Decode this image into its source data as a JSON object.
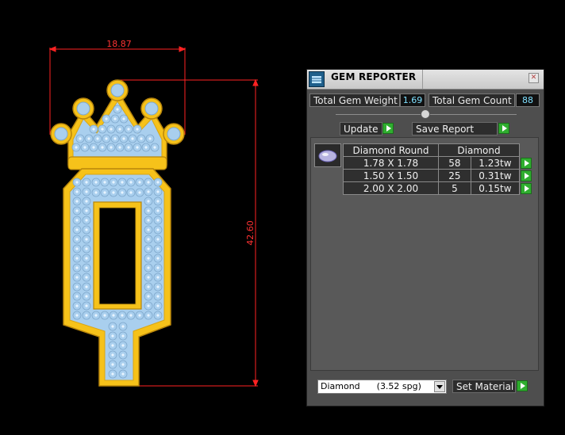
{
  "drawing": {
    "dimension_width": "18.87",
    "dimension_height": "42.60",
    "colors": {
      "gold": "#f6c21a",
      "stone": "#a9cfee",
      "dimension": "#ff2222"
    }
  },
  "panel": {
    "title": "GEM REPORTER",
    "close_glyph": "✕",
    "total_weight_label": "Total Gem Weight",
    "total_weight_value": "1.69",
    "total_count_label": "Total Gem Count",
    "total_count_value": "88",
    "update_label": "Update",
    "save_report_label": "Save Report",
    "table": {
      "headers": [
        "Diamond Round",
        "Diamond"
      ],
      "rows": [
        {
          "size": "1.78 X 1.78",
          "count": "58",
          "weight": "1.23tw"
        },
        {
          "size": "1.50 X 1.50",
          "count": "25",
          "weight": "0.31tw"
        },
        {
          "size": "2.00 X 2.00",
          "count": "5",
          "weight": "0.15tw"
        }
      ]
    },
    "material_select": "Diamond      (3.52 spg)",
    "set_material_label": "Set Material",
    "colors": {
      "accent_value": "#7fe0ff",
      "go_button": "#2fae2f"
    }
  }
}
